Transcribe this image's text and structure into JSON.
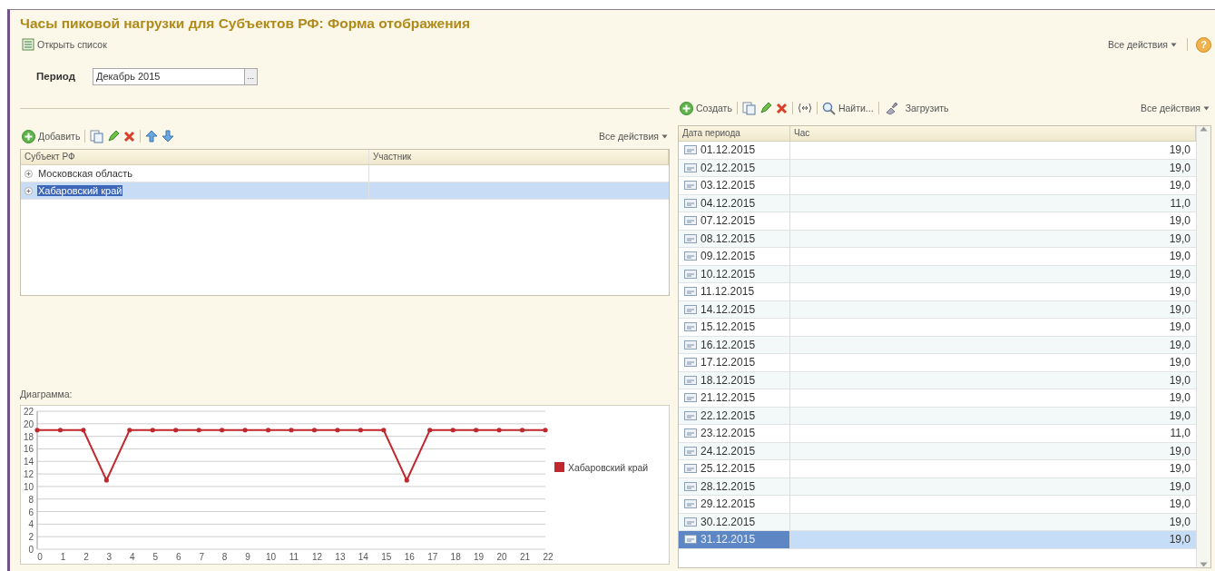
{
  "window": {
    "title": "Часы пиковой нагрузки для Субъектов РФ: Форма отображения"
  },
  "header": {
    "open_list": "Открыть список",
    "all_actions": "Все действия",
    "help": "?"
  },
  "period": {
    "label": "Период",
    "value": "Декабрь 2015",
    "select_button": "..."
  },
  "subjects": {
    "toolbar": {
      "add": "Добавить",
      "all_actions": "Все действия"
    },
    "columns": [
      "Субъект РФ",
      "Участник"
    ],
    "rows": [
      {
        "subject": "Московская область",
        "expanded": false,
        "selected": false
      },
      {
        "subject": "Хабаровский край",
        "expanded": false,
        "selected": true
      }
    ]
  },
  "diagram": {
    "label": "Диаграмма:",
    "chart_data": {
      "type": "line",
      "x": [
        0,
        1,
        2,
        3,
        4,
        5,
        6,
        7,
        8,
        9,
        10,
        11,
        12,
        13,
        14,
        15,
        16,
        17,
        18,
        19,
        20,
        21,
        22
      ],
      "series": [
        {
          "name": "Хабаровский край",
          "color": "#c0282d",
          "values": [
            19,
            19,
            19,
            11,
            19,
            19,
            19,
            19,
            19,
            19,
            19,
            19,
            19,
            19,
            19,
            19,
            11,
            19,
            19,
            19,
            19,
            19,
            19
          ]
        }
      ],
      "grid": true,
      "xlim": [
        0,
        22
      ],
      "ylim": [
        0,
        22
      ],
      "xticks": [
        0,
        1,
        2,
        3,
        4,
        5,
        6,
        7,
        8,
        9,
        10,
        11,
        12,
        13,
        14,
        15,
        16,
        17,
        18,
        19,
        20,
        21,
        22
      ],
      "yticks": [
        0,
        2,
        4,
        6,
        8,
        10,
        12,
        14,
        16,
        18,
        20,
        22
      ]
    }
  },
  "hours": {
    "toolbar": {
      "create": "Создать",
      "find": "Найти...",
      "load": "Загрузить",
      "all_actions": "Все действия"
    },
    "columns": [
      "Дата периода",
      "Час"
    ],
    "rows": [
      {
        "date": "01.12.2015",
        "hour": "19,0",
        "selected": false
      },
      {
        "date": "02.12.2015",
        "hour": "19,0",
        "selected": false
      },
      {
        "date": "03.12.2015",
        "hour": "19,0",
        "selected": false
      },
      {
        "date": "04.12.2015",
        "hour": "11,0",
        "selected": false
      },
      {
        "date": "07.12.2015",
        "hour": "19,0",
        "selected": false
      },
      {
        "date": "08.12.2015",
        "hour": "19,0",
        "selected": false
      },
      {
        "date": "09.12.2015",
        "hour": "19,0",
        "selected": false
      },
      {
        "date": "10.12.2015",
        "hour": "19,0",
        "selected": false
      },
      {
        "date": "11.12.2015",
        "hour": "19,0",
        "selected": false
      },
      {
        "date": "14.12.2015",
        "hour": "19,0",
        "selected": false
      },
      {
        "date": "15.12.2015",
        "hour": "19,0",
        "selected": false
      },
      {
        "date": "16.12.2015",
        "hour": "19,0",
        "selected": false
      },
      {
        "date": "17.12.2015",
        "hour": "19,0",
        "selected": false
      },
      {
        "date": "18.12.2015",
        "hour": "19,0",
        "selected": false
      },
      {
        "date": "21.12.2015",
        "hour": "19,0",
        "selected": false
      },
      {
        "date": "22.12.2015",
        "hour": "19,0",
        "selected": false
      },
      {
        "date": "23.12.2015",
        "hour": "11,0",
        "selected": false
      },
      {
        "date": "24.12.2015",
        "hour": "19,0",
        "selected": false
      },
      {
        "date": "25.12.2015",
        "hour": "19,0",
        "selected": false
      },
      {
        "date": "28.12.2015",
        "hour": "19,0",
        "selected": false
      },
      {
        "date": "29.12.2015",
        "hour": "19,0",
        "selected": false
      },
      {
        "date": "30.12.2015",
        "hour": "19,0",
        "selected": false
      },
      {
        "date": "31.12.2015",
        "hour": "19,0",
        "selected": true
      }
    ]
  }
}
